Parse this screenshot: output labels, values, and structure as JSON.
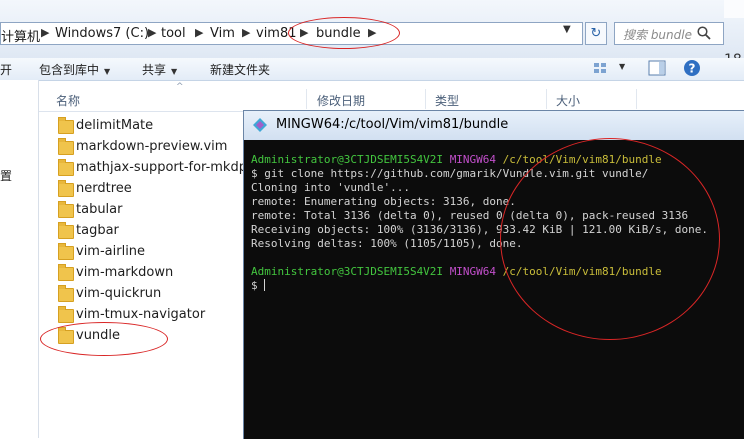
{
  "address_bar": {
    "crumbs": [
      "计算机",
      "Windows7 (C:)",
      "tool",
      "Vim",
      "vim81",
      "bundle"
    ],
    "search_placeholder": "搜索 bundle",
    "right_edge_text": "18"
  },
  "toolbar": {
    "open_label": "开",
    "include_label": "包含到库中",
    "share_label": "共享",
    "new_folder_label": "新建文件夹"
  },
  "nav_pane": {
    "partial_item": "置"
  },
  "columns": [
    "名称",
    "修改日期",
    "类型",
    "大小"
  ],
  "files": [
    "delimitMate",
    "markdown-preview.vim",
    "mathjax-support-for-mkdp",
    "nerdtree",
    "tabular",
    "tagbar",
    "vim-airline",
    "vim-markdown",
    "vim-quickrun",
    "vim-tmux-navigator",
    "vundle"
  ],
  "terminal": {
    "title": "MINGW64:/c/tool/Vim/vim81/bundle",
    "prompt_user": "Administrator@3CTJDSEMI5S4V2I",
    "prompt_env": "MINGW64",
    "prompt_path": "/c/tool/Vim/vim81/bundle",
    "lines": [
      "$ git clone https://github.com/gmarik/Vundle.vim.git vundle/",
      "Cloning into 'vundle'...",
      "remote: Enumerating objects: 3136, done.",
      "remote: Total 3136 (delta 0), reused 0 (delta 0), pack-reused 3136",
      "Receiving objects: 100% (3136/3136), 933.42 KiB | 121.00 KiB/s, done.",
      "Resolving deltas: 100% (1105/1105), done."
    ],
    "final_prompt": "$ "
  },
  "colors": {
    "prompt_green": "#43c63f",
    "prompt_magenta": "#c24fcb",
    "prompt_yellow": "#c9bd3a",
    "annotation_red": "#d92626"
  }
}
